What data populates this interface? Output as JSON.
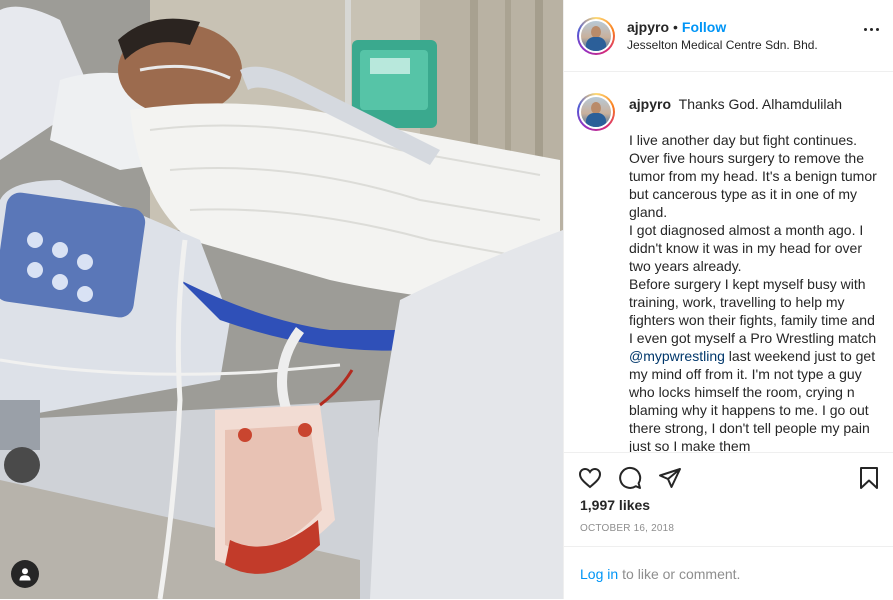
{
  "post": {
    "username": "ajpyro",
    "separator": "•",
    "follow_label": "Follow",
    "location": "Jesselton Medical Centre Sdn. Bhd.",
    "caption": {
      "username": "ajpyro",
      "first_line": "Thanks God. Alhamdulilah",
      "body_before_mention": "I live another day but fight continues. Over five hours surgery to remove the tumor from my head. It's a benign tumor but cancerous type as it in one of my gland.\nI got diagnosed almost a month ago. I didn't know it was in my head for over two years already.\nBefore surgery I kept myself busy with training, work, travelling to help my fighters won their fights, family time and I even got myself a Pro Wrestling match ",
      "mention": "@mypwrestling",
      "body_after_mention": " last weekend just to get my mind off from it. I'm not type a guy who locks himself the room, crying n blaming why it happens to me. I go out there strong, I don't tell people my pain just so I make them"
    },
    "likes": "1,997 likes",
    "date": "October 16, 2018",
    "login_link": "Log in",
    "login_suffix": "to like or comment."
  },
  "icons": {
    "like": "heart-icon",
    "comment": "comment-icon",
    "share": "paper-plane-icon",
    "save": "bookmark-icon",
    "more": "more-options-icon",
    "tags": "user-tag-icon"
  },
  "colors": {
    "accent": "#0095f6",
    "mention": "#00376b",
    "muted": "#8e8e8e",
    "border": "#efefef"
  }
}
